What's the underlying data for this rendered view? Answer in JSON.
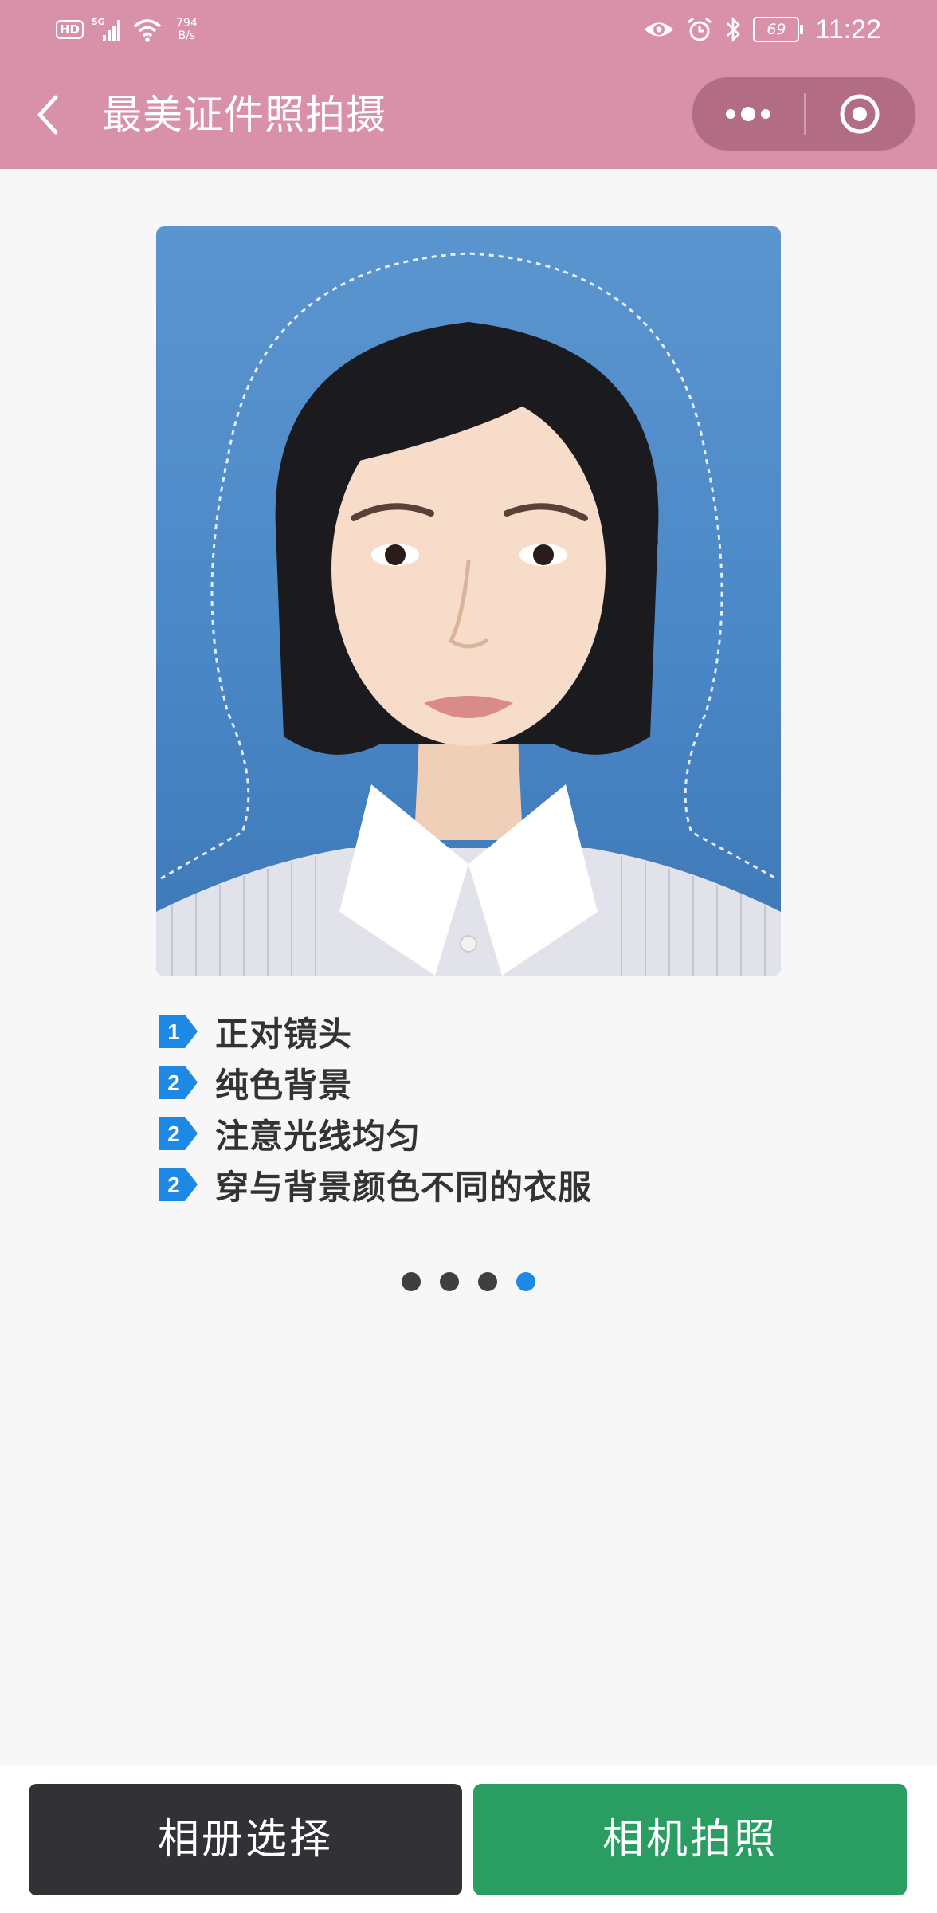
{
  "status_bar": {
    "hd": "HD",
    "network": "5G",
    "speed_value": "794",
    "speed_unit": "B/s",
    "battery": "69",
    "time": "11:22"
  },
  "nav": {
    "title": "最美证件照拍摄"
  },
  "tips": [
    {
      "num": "1",
      "text": "正对镜头"
    },
    {
      "num": "2",
      "text": "纯色背景"
    },
    {
      "num": "2",
      "text": "注意光线均匀"
    },
    {
      "num": "2",
      "text": "穿与背景颜色不同的衣服"
    }
  ],
  "carousel": {
    "count": 4,
    "active_index": 3
  },
  "buttons": {
    "album": "相册选择",
    "camera": "相机拍照"
  },
  "colors": {
    "header": "#d991a9",
    "active_dot": "#1e88e5",
    "camera_button": "#2a9d63",
    "album_button": "#313136"
  }
}
